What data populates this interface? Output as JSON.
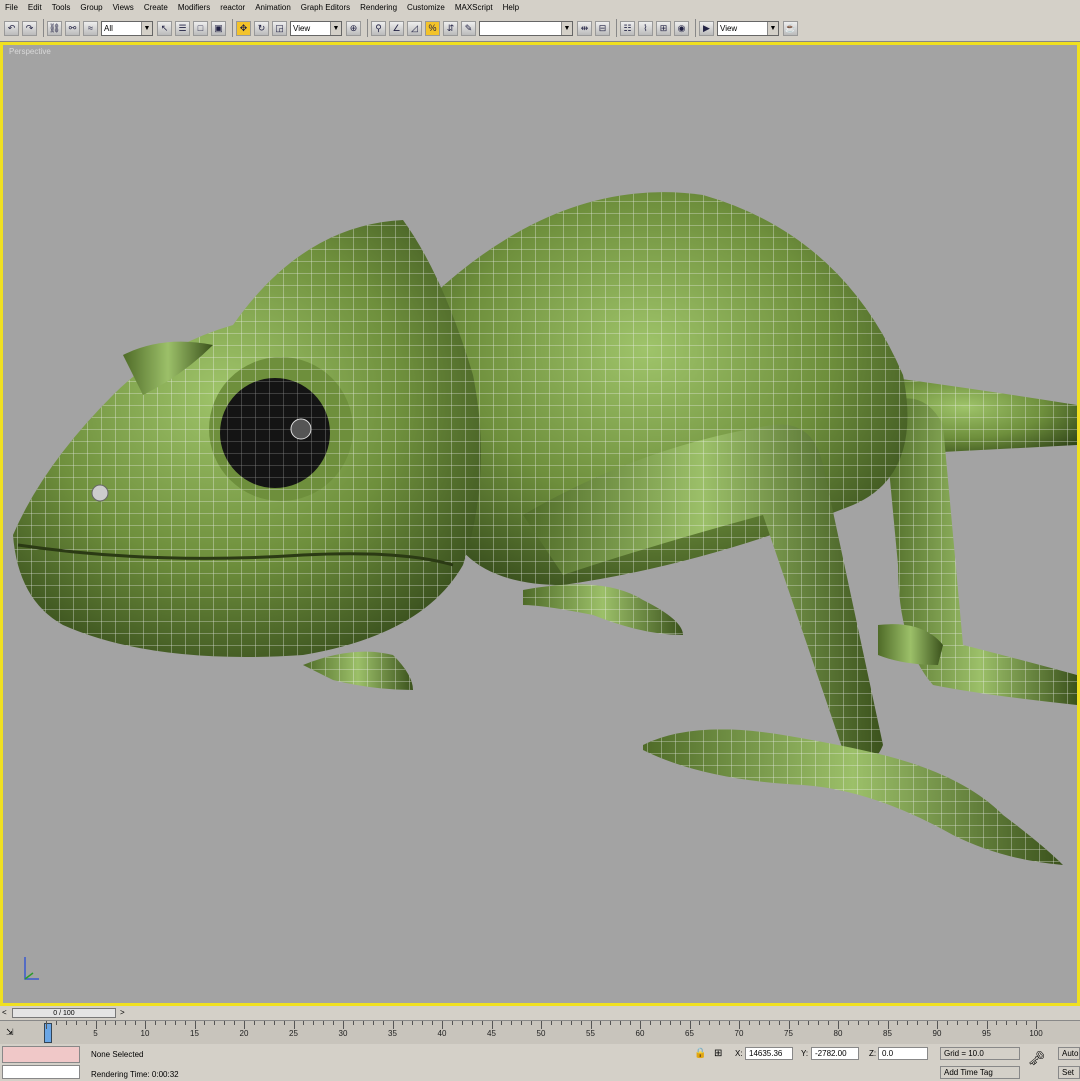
{
  "menu": [
    "File",
    "Edit",
    "Tools",
    "Group",
    "Views",
    "Create",
    "Modifiers",
    "reactor",
    "Animation",
    "Graph Editors",
    "Rendering",
    "Customize",
    "MAXScript",
    "Help"
  ],
  "toolbar": {
    "selection_filter": "All",
    "coord_system_1": "View",
    "named_selection": "",
    "coord_system_2": "View"
  },
  "viewport": {
    "label": "Perspective"
  },
  "time_slider": {
    "label": "0 / 100"
  },
  "track": {
    "ticks": [
      "5",
      "10",
      "15",
      "20",
      "25",
      "30",
      "35",
      "40",
      "45",
      "50",
      "55",
      "60",
      "65",
      "70",
      "75",
      "80",
      "85",
      "90",
      "95",
      "100"
    ]
  },
  "status": {
    "selection": "None Selected",
    "render_time": "Rendering Time: 0:00:32",
    "x_label": "X:",
    "x_value": "14635.36",
    "y_label": "Y:",
    "y_value": "-2782.00",
    "z_label": "Z:",
    "z_value": "0.0",
    "grid": "Grid = 10.0",
    "add_time_tag": "Add Time Tag",
    "auto_key": "Auto",
    "set_key": "Set"
  }
}
